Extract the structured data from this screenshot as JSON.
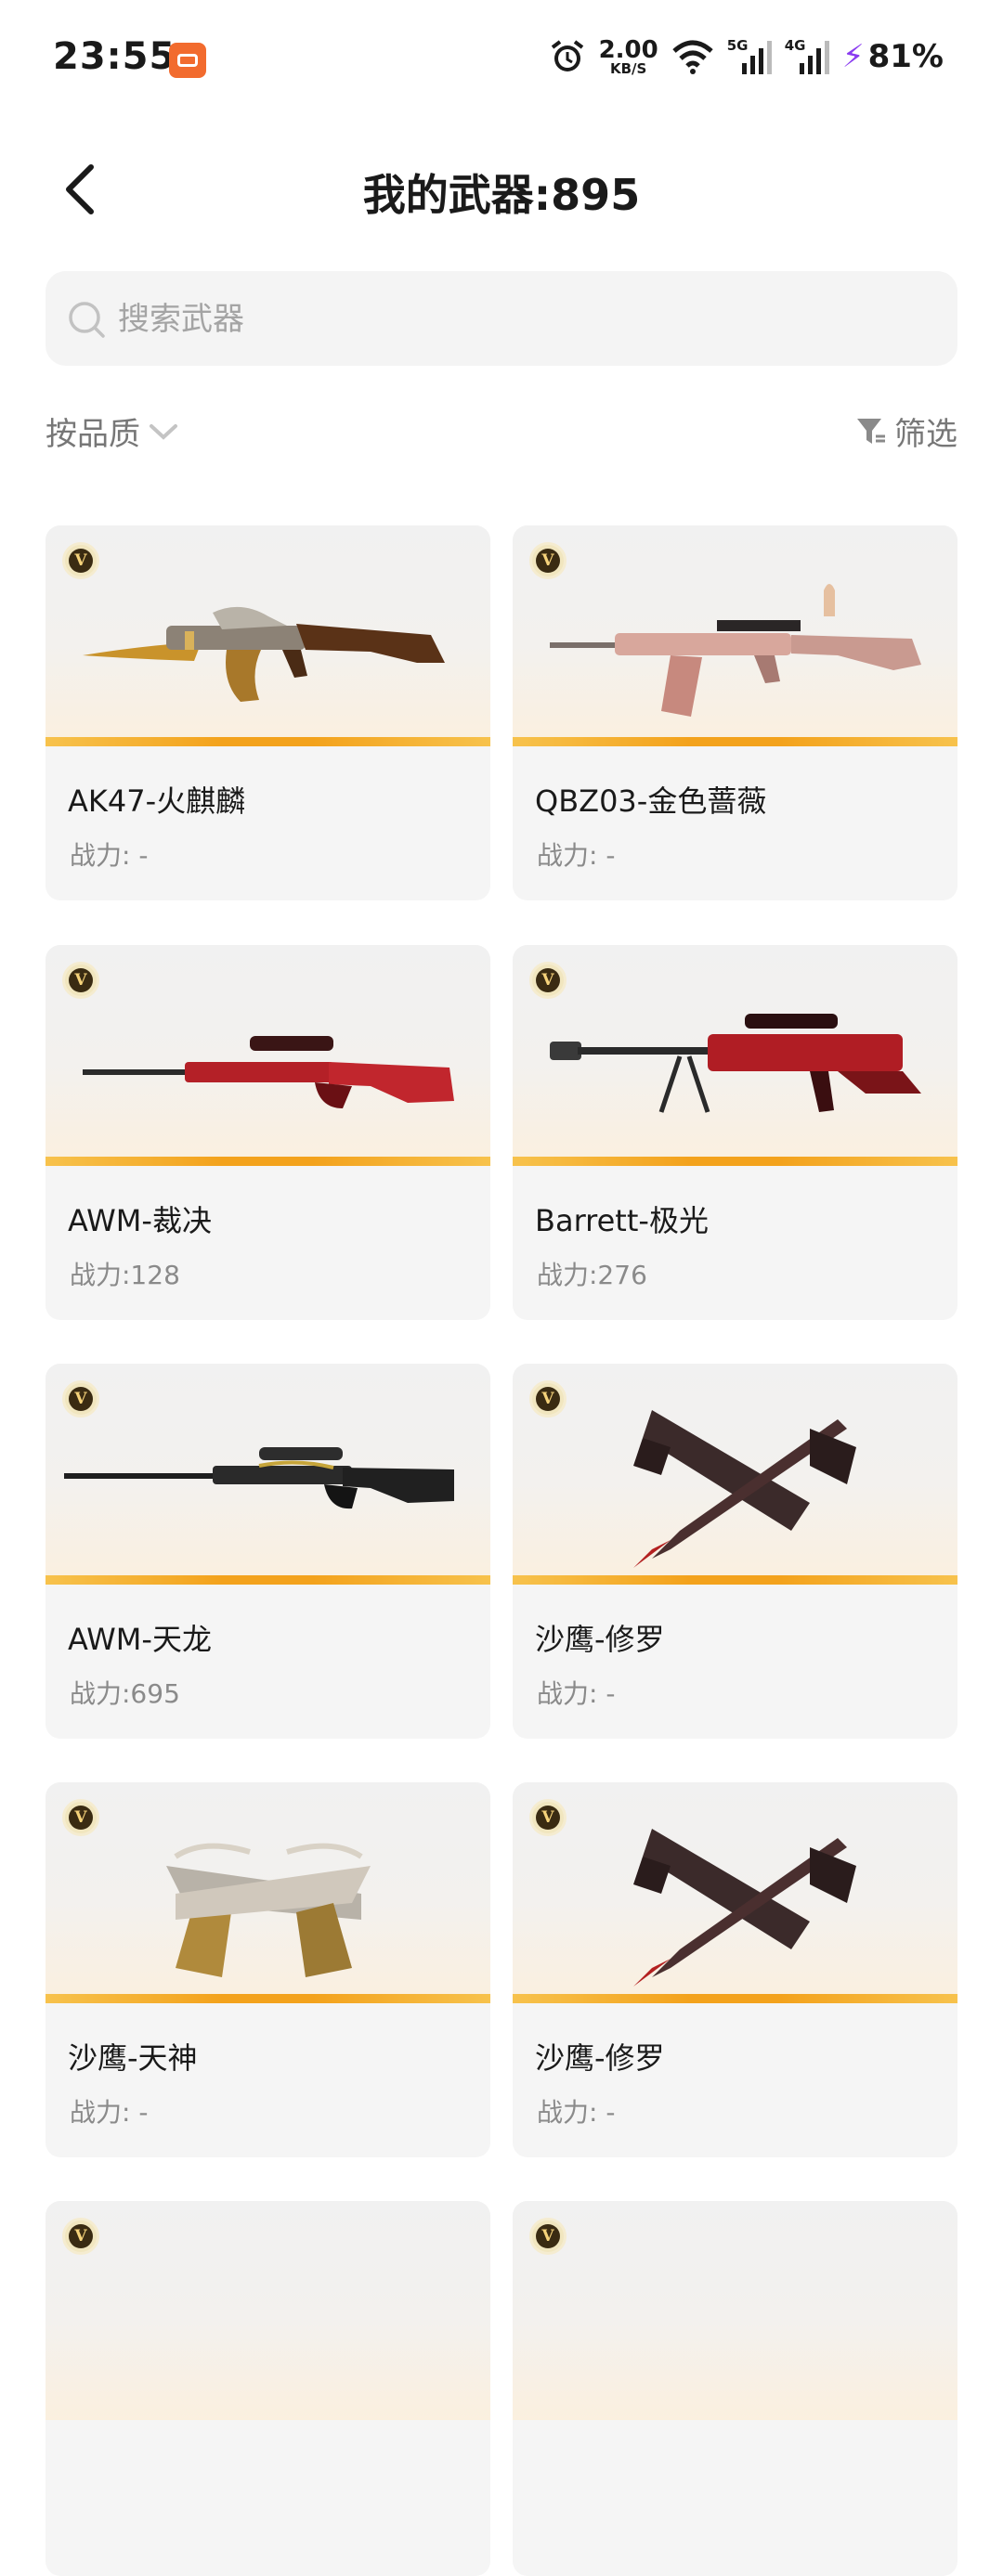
{
  "status_bar": {
    "time": "23:55",
    "speed_value": "2.00",
    "speed_unit": "KB/S",
    "net1": "5G",
    "net2": "4G",
    "battery": "81%",
    "icons": [
      "app-icon",
      "alarm-icon",
      "wifi-icon",
      "signal-icon",
      "charging-icon"
    ]
  },
  "header": {
    "title": "我的武器:895"
  },
  "search": {
    "placeholder": "搜索武器"
  },
  "sort": {
    "label": "按品质"
  },
  "filter": {
    "label": "筛选"
  },
  "cards": [
    {
      "name": "AK47-火麒麟",
      "power": "战力: -",
      "badge": "V",
      "weapon_icon": "rifle-gold-icon"
    },
    {
      "name": "QBZ03-金色蔷薇",
      "power": "战力: -",
      "badge": "V",
      "weapon_icon": "rifle-pink-icon"
    },
    {
      "name": "AWM-裁决",
      "power": "战力:128",
      "badge": "V",
      "weapon_icon": "sniper-red-icon"
    },
    {
      "name": "Barrett-极光",
      "power": "战力:276",
      "badge": "V",
      "weapon_icon": "sniper-heavy-red-icon"
    },
    {
      "name": "AWM-天龙",
      "power": "战力:695",
      "badge": "V",
      "weapon_icon": "sniper-black-icon"
    },
    {
      "name": "沙鹰-修罗",
      "power": "战力: -",
      "badge": "V",
      "weapon_icon": "pistols-dark-icon"
    },
    {
      "name": "沙鹰-天神",
      "power": "战力: -",
      "badge": "V",
      "weapon_icon": "pistols-gold-icon"
    },
    {
      "name": "沙鹰-修罗",
      "power": "战力: -",
      "badge": "V",
      "weapon_icon": "pistols-dark-icon"
    },
    {
      "badge": "V"
    },
    {
      "badge": "V"
    }
  ],
  "colors": {
    "accent_orange": "#f3a21c",
    "card_bg": "#f5f5f5",
    "search_bg": "#f4f4f4",
    "muted_text": "#8a8a8a"
  }
}
